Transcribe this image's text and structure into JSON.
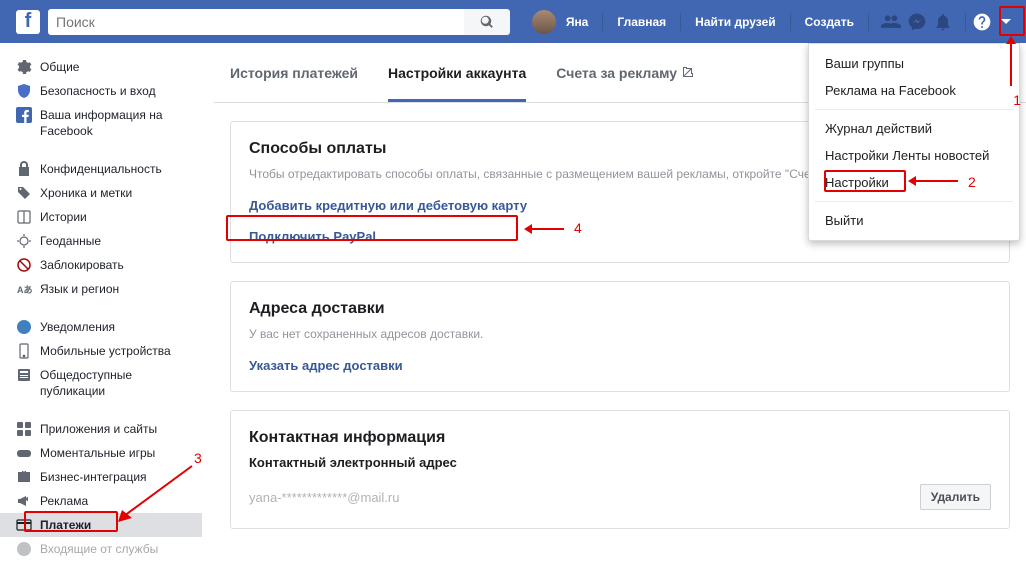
{
  "header": {
    "search_placeholder": "Поиск",
    "username": "Яна",
    "nav": {
      "home": "Главная",
      "find_friends": "Найти друзей",
      "create": "Создать"
    }
  },
  "dropdown": {
    "items": [
      "Ваши группы",
      "Реклама на Facebook",
      "Журнал действий",
      "Настройки Ленты новостей",
      "Настройки",
      "Выйти"
    ]
  },
  "sidebar": {
    "general": "Общие",
    "security": "Безопасность и вход",
    "your_info": "Ваша информация на Facebook",
    "privacy": "Конфиденциальность",
    "timeline": "Хроника и метки",
    "stories": "Истории",
    "location": "Геоданные",
    "blocking": "Заблокировать",
    "language": "Язык и регион",
    "notifications": "Уведомления",
    "mobile": "Мобильные устройства",
    "public_posts": "Общедоступные публикации",
    "apps": "Приложения и сайты",
    "instant_games": "Моментальные игры",
    "business": "Бизнес-интеграция",
    "ads": "Реклама",
    "payments": "Платежи",
    "support": "Входящие от службы"
  },
  "tabs": {
    "history": "История платежей",
    "settings": "Настройки аккаунта",
    "invoices": "Счета за рекламу"
  },
  "payment": {
    "title": "Способы оплаты",
    "subtitle": "Чтобы отредактировать способы оплаты, связанные с размещением вашей рекламы, откройте \"Счета за рекламу\".",
    "add_card": "Добавить кредитную или дебетовую карту",
    "connect_paypal": "Подключить PayPal"
  },
  "shipping": {
    "title": "Адреса доставки",
    "subtitle": "У вас нет сохраненных адресов доставки.",
    "add": "Указать адрес доставки"
  },
  "contact": {
    "title": "Контактная информация",
    "label": "Контактный электронный адрес",
    "email": "yana-*************@mail.ru",
    "delete": "Удалить"
  },
  "annotations": {
    "1": "1",
    "2": "2",
    "3": "3",
    "4": "4"
  }
}
